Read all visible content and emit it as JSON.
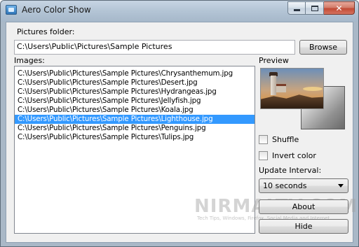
{
  "window": {
    "title": "Aero Color Show",
    "controls": {
      "minimize": "minimize",
      "maximize": "maximize",
      "close": "✕"
    }
  },
  "folder": {
    "label": "Pictures folder:",
    "value": "C:\\Users\\Public\\Pictures\\Sample Pictures",
    "browse_label": "Browse"
  },
  "images": {
    "label": "Images:",
    "items": [
      "C:\\Users\\Public\\Pictures\\Sample Pictures\\Chrysanthemum.jpg",
      "C:\\Users\\Public\\Pictures\\Sample Pictures\\Desert.jpg",
      "C:\\Users\\Public\\Pictures\\Sample Pictures\\Hydrangeas.jpg",
      "C:\\Users\\Public\\Pictures\\Sample Pictures\\Jellyfish.jpg",
      "C:\\Users\\Public\\Pictures\\Sample Pictures\\Koala.jpg",
      "C:\\Users\\Public\\Pictures\\Sample Pictures\\Lighthouse.jpg",
      "C:\\Users\\Public\\Pictures\\Sample Pictures\\Penguins.jpg",
      "C:\\Users\\Public\\Pictures\\Sample Pictures\\Tulips.jpg"
    ],
    "selected_index": 5
  },
  "preview": {
    "label": "Preview"
  },
  "options": {
    "shuffle_label": "Shuffle",
    "shuffle_checked": false,
    "invert_label": "Invert color",
    "invert_checked": false,
    "interval_label": "Update Interval:",
    "interval_value": "10 seconds"
  },
  "buttons": {
    "about_label": "About",
    "hide_label": "Hide"
  },
  "watermark": {
    "main": "NIRMALTV.COM",
    "sub": "Tech Tips, Windows, Firefox, Social Media and Internet"
  },
  "colors": {
    "selection": "#3399ff",
    "window_frame": "#a9b8c7",
    "client_bg": "#f0f0f0"
  }
}
